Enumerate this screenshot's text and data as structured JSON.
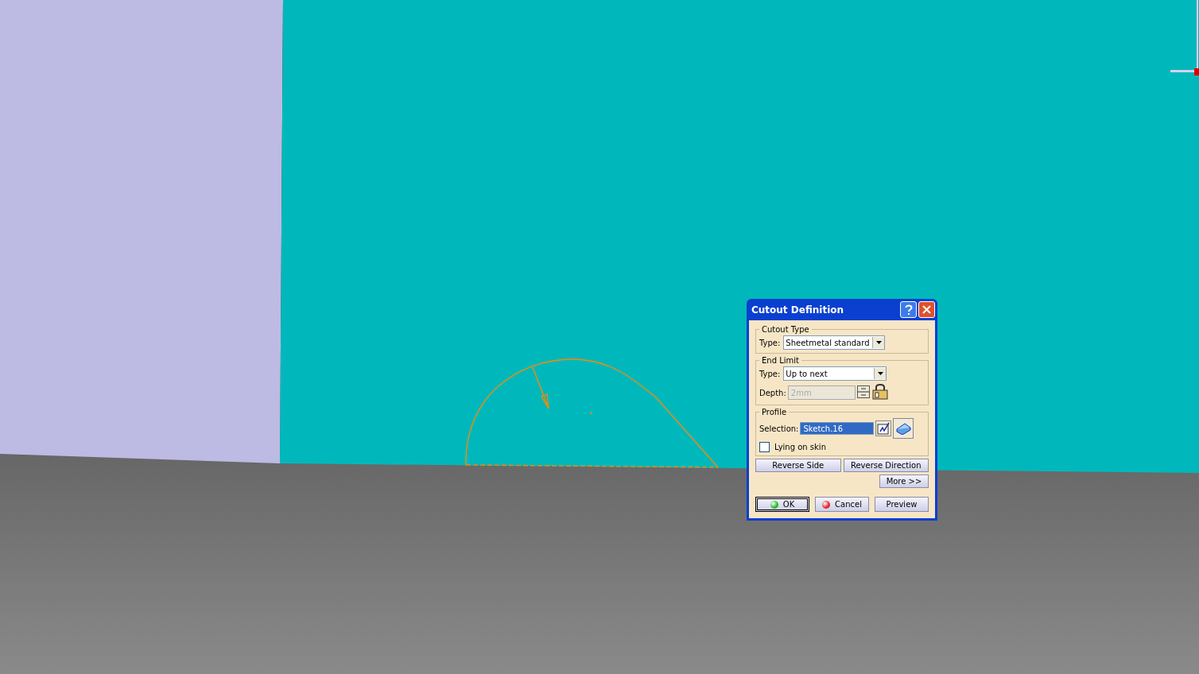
{
  "dialog": {
    "title": "Cutout Definition",
    "cutout_type": {
      "legend": "Cutout Type",
      "type_label": "Type:",
      "type_value": "Sheetmetal standard"
    },
    "end_limit": {
      "legend": "End Limit",
      "type_label": "Type:",
      "type_value": "Up to next",
      "depth_label": "Depth:",
      "depth_value": "2mm",
      "depth_disabled": true
    },
    "profile": {
      "legend": "Profile",
      "selection_label": "Selection:",
      "selection_value": "Sketch.16"
    },
    "lying_on_skin": {
      "label": "Lying on skin",
      "checked": false
    },
    "buttons": [
      {
        "label": "Reverse Side",
        "kind": "plain"
      },
      {
        "label": "Reverse Direction",
        "kind": "plain"
      },
      {
        "label": "More >>",
        "kind": "more"
      }
    ],
    "footer": [
      {
        "label": "OK",
        "kind": "ok"
      },
      {
        "label": "Cancel",
        "kind": "cancel"
      },
      {
        "label": "Preview",
        "kind": "plain"
      }
    ]
  }
}
